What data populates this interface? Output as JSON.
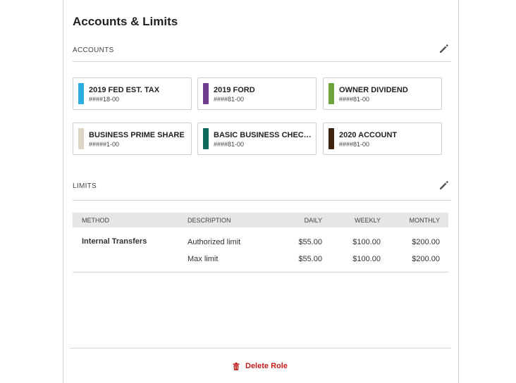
{
  "header": {
    "title": "Accounts & Limits"
  },
  "accounts_section": {
    "label": "ACCOUNTS",
    "edit_icon": "pencil-icon",
    "accounts": [
      {
        "name": "2019 FED EST. TAX",
        "number": "####18-00",
        "color": "#2aaee2"
      },
      {
        "name": "2019 FORD",
        "number": "####81-00",
        "color": "#6f3c8e"
      },
      {
        "name": "OWNER DIVIDEND",
        "number": "####81-00",
        "color": "#6da33a"
      },
      {
        "name": "BUSINESS PRIME SHARE",
        "number": "#####1-00",
        "color": "#ded6c4"
      },
      {
        "name": "BASIC BUSINESS CHECKI…",
        "number": "####81-00",
        "color": "#0e6b5c"
      },
      {
        "name": "2020 ACCOUNT",
        "number": "####81-00",
        "color": "#3b2510"
      }
    ]
  },
  "limits_section": {
    "label": "LIMITS",
    "edit_icon": "pencil-icon",
    "columns": [
      "METHOD",
      "DESCRIPTION",
      "DAILY",
      "WEEKLY",
      "MONTHLY"
    ],
    "rows": [
      {
        "method": "Internal Transfers",
        "description": "Authorized limit",
        "daily": "$55.00",
        "weekly": "$100.00",
        "monthly": "$200.00"
      },
      {
        "method": "",
        "description": "Max limit",
        "daily": "$55.00",
        "weekly": "$100.00",
        "monthly": "$200.00"
      }
    ]
  },
  "footer": {
    "delete_label": "Delete Role",
    "delete_icon": "trash-icon",
    "delete_color": "#c41c1c"
  }
}
